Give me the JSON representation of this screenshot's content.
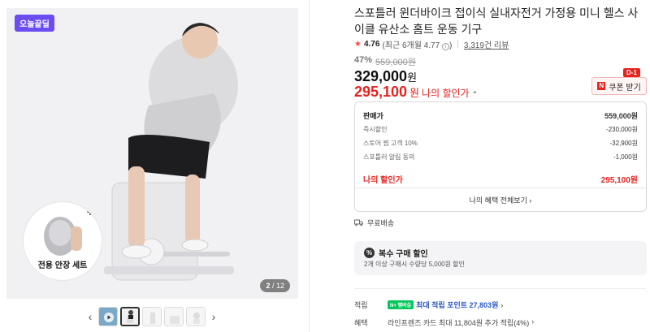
{
  "gallery": {
    "badge": "오늘끝딜",
    "counter_current": "2",
    "counter_total": "/ 12",
    "set_label": "전용 안장 세트",
    "set_plus": "+"
  },
  "product": {
    "title": "스포틀러 윈더바이크 접이식 실내자전거 가정용 미니 헬스 사이클 유산소 홈트 운동 기구",
    "rating": "4.76",
    "rating_recent": "(최근 6개월 4.77",
    "rating_recent_close": ")",
    "reviews": "3,319건 리뷰",
    "discount_pct": "47%",
    "original_price": "559,000원",
    "price": "329,000",
    "price_unit": "원",
    "my_price": "295,100",
    "my_price_unit": "원",
    "my_price_label": "나의 할인가"
  },
  "coupon": {
    "label": "쿠폰 받기",
    "dday": "D-1",
    "icon": "coupon-icon"
  },
  "benefits": {
    "rows": [
      {
        "label": "판매가",
        "value": "559,000원"
      },
      {
        "label": "즉시할인",
        "value": "-230,000원"
      },
      {
        "label": "스토어 찜 고객 10%",
        "value": "-32,900원"
      },
      {
        "label": "스포틀러 알림 동의",
        "value": "-1,000원"
      }
    ],
    "my_label": "나의 할인가",
    "my_value": "295,100원",
    "more": "나의 혜택 전체보기 ›"
  },
  "shipping": {
    "label": "무료배송",
    "icon": "truck-icon"
  },
  "multi_purchase": {
    "title": "복수 구매 할인",
    "desc": "2개 이상 구매시 수량당 5,000원 할인",
    "icon": "percent-icon"
  },
  "points": {
    "label": "적립",
    "badge": "N+ 멤버십",
    "text": "최대 적립 포인트 27,803원",
    "arrow": "›"
  },
  "card": {
    "label": "혜택",
    "text": "라인프렌즈 카드 최대 11,804원 추가 적립(4%)",
    "arrow": "›"
  },
  "colors": {
    "accent_red": "#e8231f",
    "badge_purple": "#6a4cf0",
    "naver_green": "#03c75a",
    "link_blue": "#2a57c4"
  }
}
